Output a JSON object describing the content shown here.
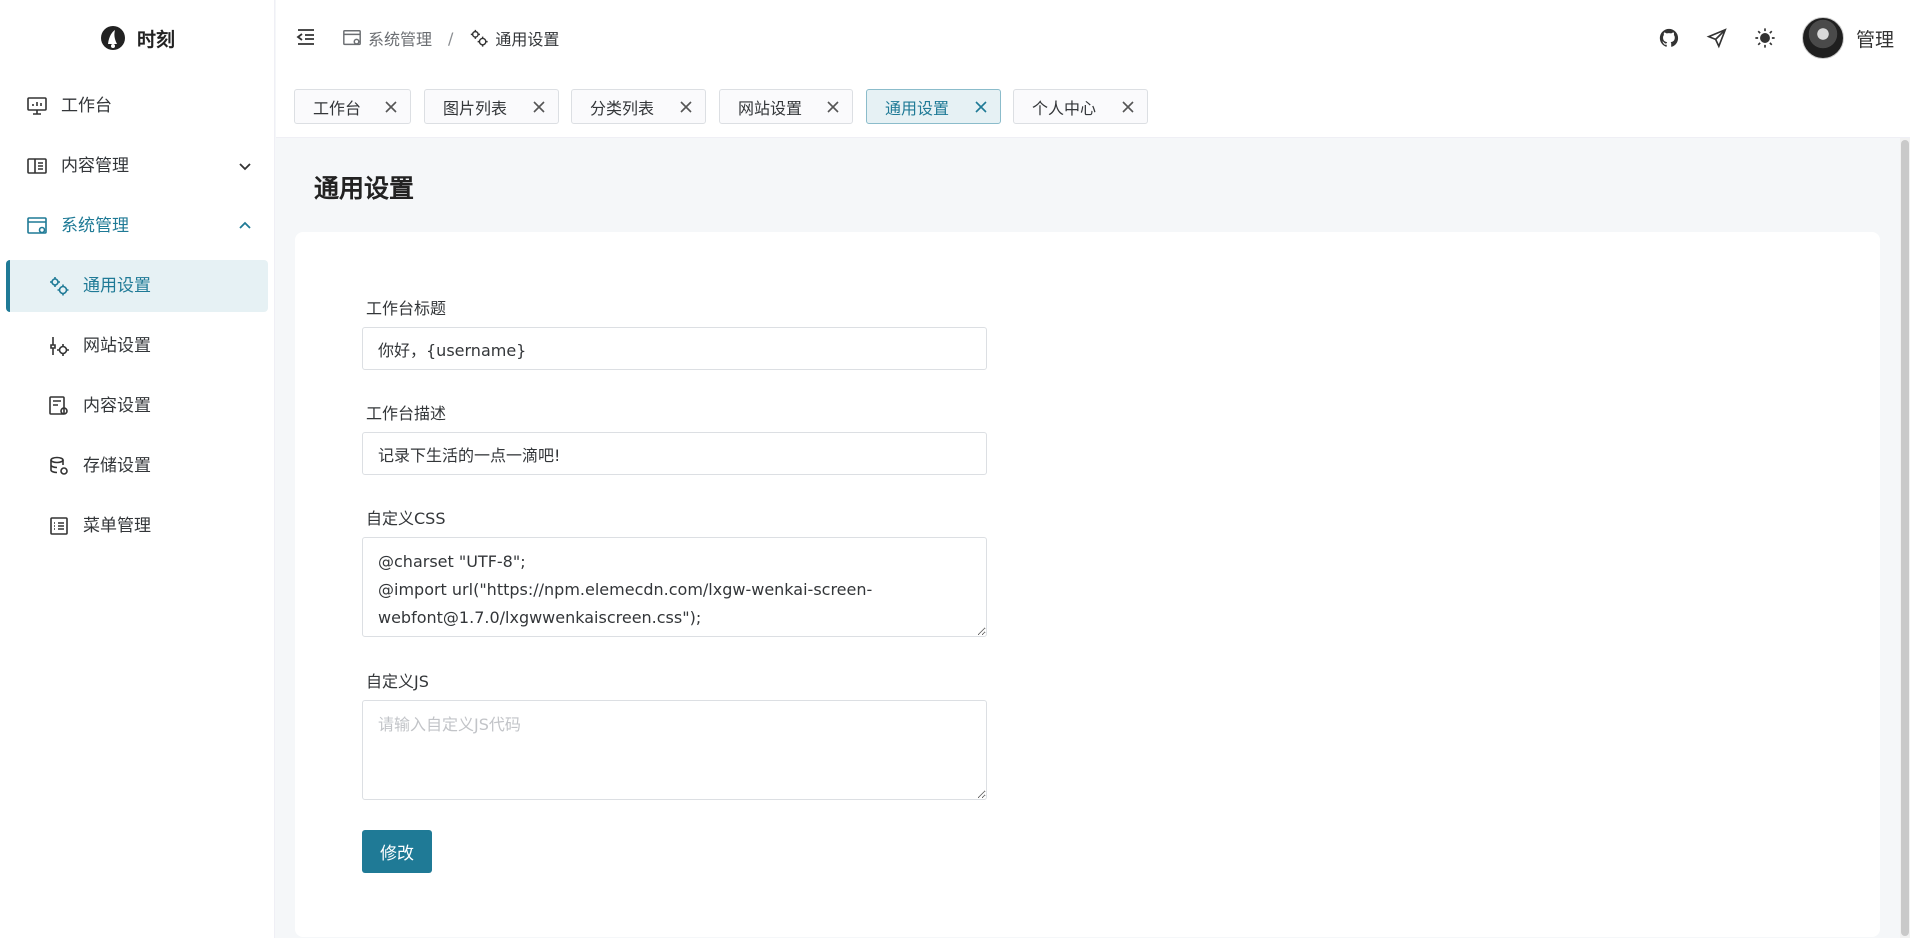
{
  "app": {
    "name": "时刻"
  },
  "sidebar": {
    "items": [
      {
        "label": "工作台",
        "icon": "monitor-icon"
      },
      {
        "label": "内容管理",
        "icon": "book-open-icon",
        "arrow": "chevron-down-icon"
      },
      {
        "label": "系统管理",
        "icon": "window-settings-icon",
        "arrow": "chevron-up-icon",
        "expanded": true
      },
      {
        "label": "通用设置",
        "icon": "gears-icon",
        "active": true
      },
      {
        "label": "网站设置",
        "icon": "tools-icon"
      },
      {
        "label": "内容设置",
        "icon": "file-settings-icon"
      },
      {
        "label": "存储设置",
        "icon": "database-settings-icon"
      },
      {
        "label": "菜单管理",
        "icon": "list-icon"
      }
    ]
  },
  "header": {
    "breadcrumb": [
      {
        "label": "系统管理",
        "icon": "window-settings-icon"
      },
      {
        "label": "通用设置",
        "icon": "gears-icon"
      }
    ],
    "breadcrumb_separator": "/",
    "user_name": "管理",
    "actions": [
      "github-icon",
      "send-icon",
      "sun-icon"
    ]
  },
  "tabs": [
    {
      "label": "工作台"
    },
    {
      "label": "图片列表"
    },
    {
      "label": "分类列表"
    },
    {
      "label": "网站设置"
    },
    {
      "label": "通用设置",
      "active": true
    },
    {
      "label": "个人中心"
    }
  ],
  "page": {
    "title": "通用设置",
    "form": {
      "dashboard_title": {
        "label": "工作台标题",
        "value": "你好，{username}"
      },
      "dashboard_desc": {
        "label": "工作台描述",
        "value": "记录下生活的一点一滴吧!"
      },
      "custom_css": {
        "label": "自定义CSS",
        "value": "@charset \"UTF-8\";\n@import url(\"https://npm.elemecdn.com/lxgw-wenkai-screen-webfont@1.7.0/lxgwwenkaiscreen.css\");\nbody {"
      },
      "custom_js": {
        "label": "自定义JS",
        "value": "",
        "placeholder": "请输入自定义JS代码"
      },
      "submit_label": "修改"
    }
  },
  "colors": {
    "accent": "#1f7a96",
    "accent_light": "#e6f1f4",
    "content_bg": "#f5f7f9"
  }
}
